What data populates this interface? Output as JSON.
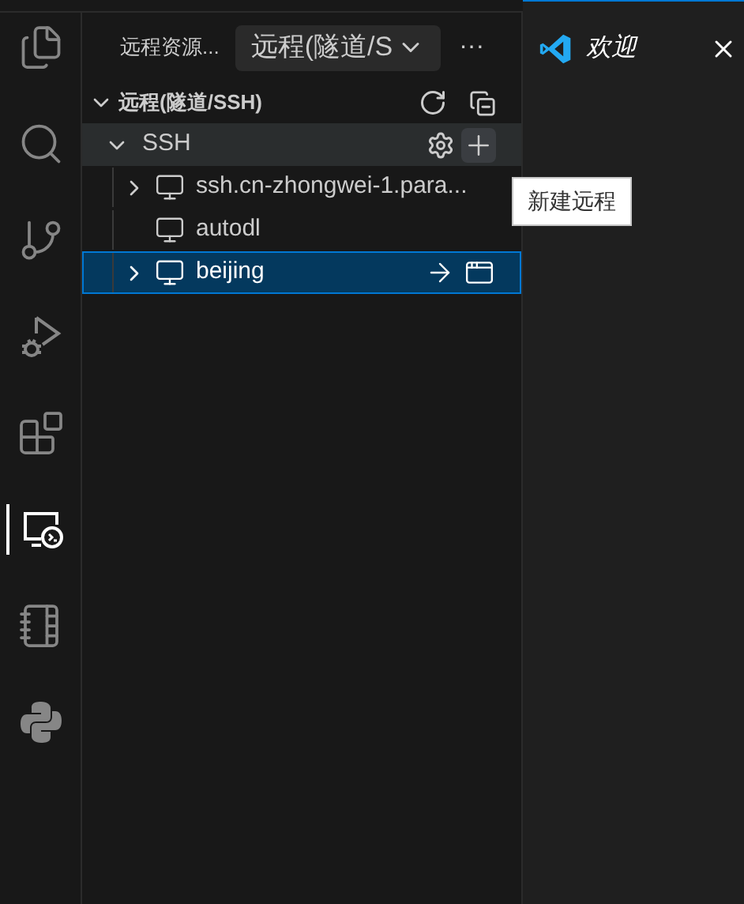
{
  "activity_bar": {
    "items": [
      {
        "kind": "files",
        "selected": false
      },
      {
        "kind": "search",
        "selected": false
      },
      {
        "kind": "source-control",
        "selected": false
      },
      {
        "kind": "run-debug",
        "selected": false
      },
      {
        "kind": "extensions",
        "selected": false
      },
      {
        "kind": "remote",
        "selected": true
      },
      {
        "kind": "notebook",
        "selected": false
      },
      {
        "kind": "python",
        "selected": false
      }
    ]
  },
  "sidebar": {
    "title": "远程资源...",
    "dropdown": {
      "value": "远程(隧道/S"
    },
    "more": "···",
    "section": {
      "title": "远程(隧道/SSH)",
      "expanded": true,
      "groups": [
        {
          "label": "SSH",
          "expanded": true,
          "hovered": true,
          "children": [
            {
              "label": "ssh.cn-zhongwei-1.para...",
              "expandable": true,
              "selected": false
            },
            {
              "label": "autodl",
              "expandable": false,
              "selected": false
            },
            {
              "label": "beijing",
              "expandable": true,
              "selected": true
            }
          ]
        }
      ]
    }
  },
  "tooltip": {
    "text": "新建远程"
  },
  "editor": {
    "tab": {
      "label": "欢迎"
    }
  }
}
